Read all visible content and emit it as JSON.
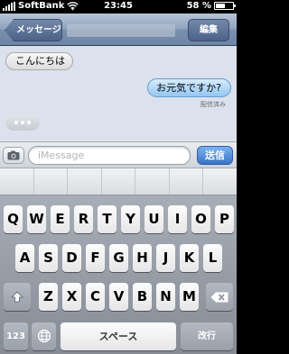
{
  "status_bar": {
    "carrier": "SoftBank",
    "time": "23:45",
    "battery_percent": "58 %",
    "battery_level": 0.58
  },
  "nav": {
    "back_label": "メッセージ",
    "edit_label": "編集"
  },
  "messages": [
    {
      "text": "こんにちは",
      "direction": "incoming"
    },
    {
      "text": "お元気ですか?",
      "direction": "outgoing"
    }
  ],
  "delivered_label": "配信済み",
  "input": {
    "placeholder": "iMessage",
    "send_label": "送信"
  },
  "keyboard": {
    "row1": [
      "Q",
      "W",
      "E",
      "R",
      "T",
      "Y",
      "U",
      "I",
      "O",
      "P"
    ],
    "row2": [
      "A",
      "S",
      "D",
      "F",
      "G",
      "H",
      "J",
      "K",
      "L"
    ],
    "row3": [
      "Z",
      "X",
      "C",
      "V",
      "B",
      "N",
      "M"
    ],
    "numbers_label": "123",
    "space_label": "スペース",
    "return_label": "改行"
  },
  "colors": {
    "nav_bar": "#8ea2bd",
    "messages_bg": "#dbe2ed",
    "send_button": "#3874c8"
  }
}
